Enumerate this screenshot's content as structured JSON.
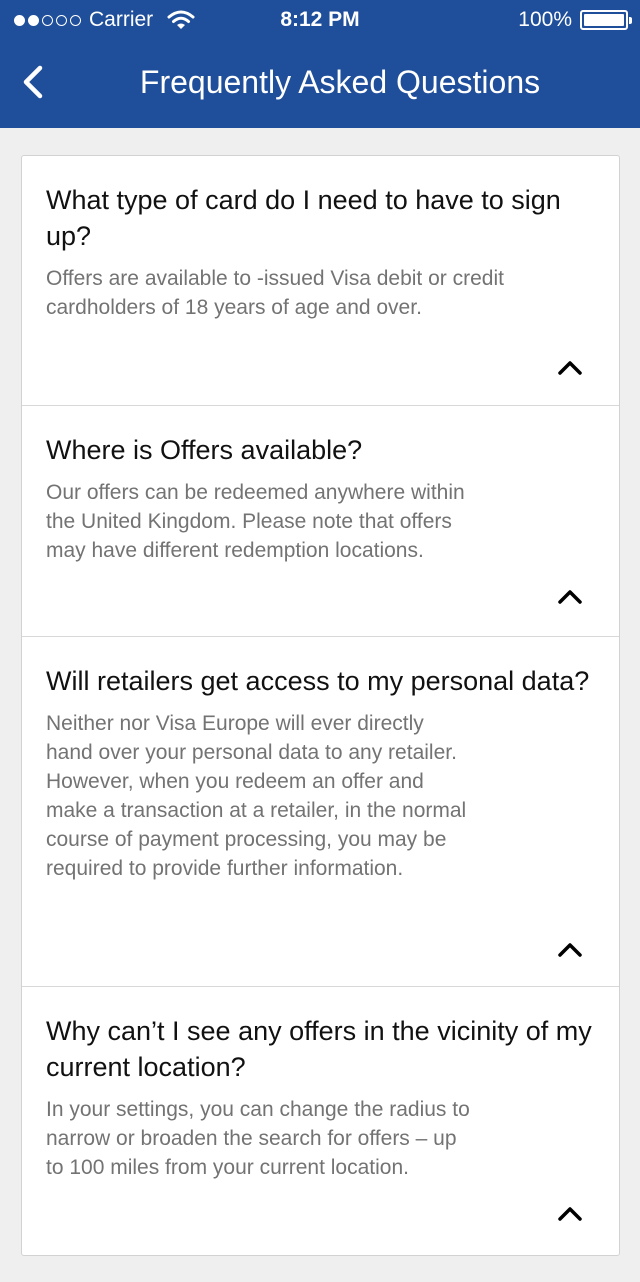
{
  "status_bar": {
    "carrier": "Carrier",
    "time": "8:12 PM",
    "battery": "100%"
  },
  "nav": {
    "title": "Frequently Asked Questions",
    "back_icon": "chevron-left-icon"
  },
  "faqs": [
    {
      "question": "What type of card do I need to have to sign up?",
      "answer": "Offers are available to -issued Visa debit or credit\ncardholders of 18 years of age and over.",
      "expanded_icon": "chevron-up-icon"
    },
    {
      "question": "Where is  Offers available?",
      "answer": "Our offers can be redeemed anywhere within\nthe United Kingdom. Please note that offers\nmay have different redemption locations.",
      "expanded_icon": "chevron-up-icon"
    },
    {
      "question": "Will retailers get access to my personal data?",
      "answer": "Neither  nor Visa Europe will ever directly\nhand over your personal data to any retailer.\nHowever, when you redeem an offer and\nmake a transaction at a retailer, in the normal\ncourse of payment processing, you may be\nrequired to provide further information.",
      "expanded_icon": "chevron-up-icon"
    },
    {
      "question": "Why can’t I see any offers in the vicinity of my current location?",
      "answer": "In your settings, you can change the radius to\nnarrow or broaden the search for offers – up\nto 100 miles from your current location.",
      "expanded_icon": "chevron-up-icon"
    }
  ],
  "colors": {
    "header": "#1f4e9a",
    "background": "#efefef",
    "answer_text": "#737373"
  }
}
